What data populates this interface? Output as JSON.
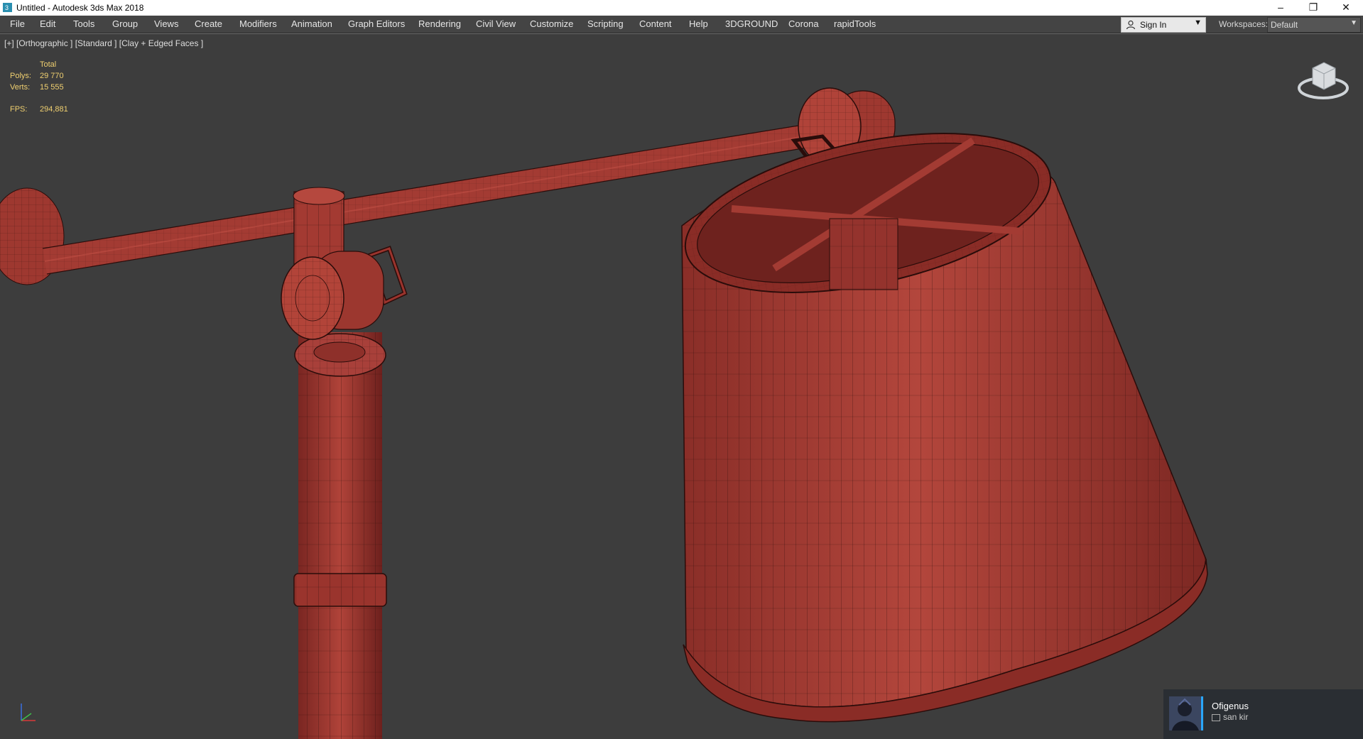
{
  "window": {
    "title": "Untitled - Autodesk 3ds Max 2018",
    "controls": {
      "minimize": "–",
      "restore": "❐",
      "close": "✕"
    }
  },
  "menu": {
    "items": [
      "File",
      "Edit",
      "Tools",
      "Group",
      "Views",
      "Create",
      "Modifiers",
      "Animation",
      "Graph Editors",
      "Rendering",
      "Civil View",
      "Customize",
      "Scripting",
      "Content",
      "Help",
      "3DGROUND",
      "Corona",
      "rapidTools"
    ]
  },
  "account": {
    "sign_in": "Sign In"
  },
  "workspace": {
    "label": "Workspaces:",
    "value": "Default"
  },
  "viewport": {
    "label": "[+] [Orthographic ] [Standard ] [Clay + Edged Faces ]",
    "stats": {
      "header": "Total",
      "polys_label": "Polys:",
      "polys_value": "29 770",
      "verts_label": "Verts:",
      "verts_value": "15 555",
      "fps_label": "FPS:",
      "fps_value": "294,881"
    }
  },
  "notification": {
    "name": "Ofigenus",
    "message": "san kir"
  },
  "colors": {
    "viewport_bg": "#3d3d3d",
    "model_clay": "#a03a32",
    "wire": "#2a0c0a",
    "stats_text": "#f0d070"
  }
}
